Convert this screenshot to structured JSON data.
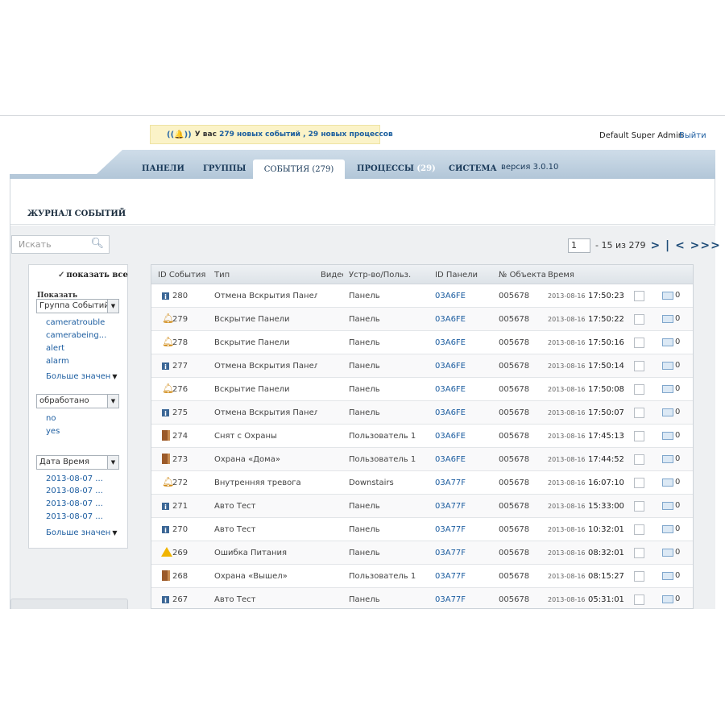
{
  "notice": {
    "prefix": "У вас",
    "events_count": "279",
    "events_text": "новых событий ,",
    "processes_count": "29",
    "processes_text": "новых процессов"
  },
  "header": {
    "user": "Default Super Admin",
    "logout": "Выйти"
  },
  "nav": {
    "tabs": [
      {
        "label": "ПАНЕЛИ"
      },
      {
        "label": "ГРУППЫ"
      },
      {
        "label": "СОБЫТИЯ (279)",
        "active": true
      },
      {
        "label": "ПРОЦЕССЫ",
        "count": "(29)"
      },
      {
        "label": "СИСТЕМА"
      }
    ],
    "version": "версия 3.0.10"
  },
  "page_title": "ЖУРНАЛ СОБЫТИЙ",
  "search": {
    "placeholder": "Искать"
  },
  "pager": {
    "page": "1",
    "range": "- 15 из 279"
  },
  "filter": {
    "show_all": "показать все",
    "show_label": "Показать",
    "group_select": "Группа Событий",
    "group_items": [
      "cameratrouble",
      "camerabeing...",
      "alert",
      "alarm"
    ],
    "more": "Больше значен",
    "processed_select": "обработано",
    "processed_items": [
      "no",
      "yes"
    ],
    "date_select": "Дата Время",
    "date_items": [
      "2013-08-07 ...",
      "2013-08-07 ...",
      "2013-08-07 ...",
      "2013-08-07 ..."
    ],
    "more2": "Больше значен"
  },
  "table": {
    "headers": [
      "ID События",
      "Тип",
      "Видео",
      "Устр-во/Польз.",
      "ID Панели",
      "№ Объекта",
      "Время"
    ],
    "rows": [
      {
        "icon": "info",
        "id": "280",
        "type": "Отмена Вскрытия Панели",
        "device": "Панель",
        "panel": "03A6FE",
        "object": "005678",
        "date": "2013-08-16",
        "time": "17:50:23",
        "mail": "0"
      },
      {
        "icon": "bell",
        "id": "279",
        "type": "Вскрытие Панели",
        "device": "Панель",
        "panel": "03A6FE",
        "object": "005678",
        "date": "2013-08-16",
        "time": "17:50:22",
        "mail": "0"
      },
      {
        "icon": "bell",
        "id": "278",
        "type": "Вскрытие Панели",
        "device": "Панель",
        "panel": "03A6FE",
        "object": "005678",
        "date": "2013-08-16",
        "time": "17:50:16",
        "mail": "0"
      },
      {
        "icon": "info",
        "id": "277",
        "type": "Отмена Вскрытия Панели",
        "device": "Панель",
        "panel": "03A6FE",
        "object": "005678",
        "date": "2013-08-16",
        "time": "17:50:14",
        "mail": "0"
      },
      {
        "icon": "bell",
        "id": "276",
        "type": "Вскрытие Панели",
        "device": "Панель",
        "panel": "03A6FE",
        "object": "005678",
        "date": "2013-08-16",
        "time": "17:50:08",
        "mail": "0"
      },
      {
        "icon": "info",
        "id": "275",
        "type": "Отмена Вскрытия Панели",
        "device": "Панель",
        "panel": "03A6FE",
        "object": "005678",
        "date": "2013-08-16",
        "time": "17:50:07",
        "mail": "0"
      },
      {
        "icon": "door",
        "id": "274",
        "type": "Снят с Охраны",
        "device": "Пользователь 1",
        "panel": "03A6FE",
        "object": "005678",
        "date": "2013-08-16",
        "time": "17:45:13",
        "mail": "0"
      },
      {
        "icon": "door",
        "id": "273",
        "type": "Охрана «Дома»",
        "device": "Пользователь 1",
        "panel": "03A6FE",
        "object": "005678",
        "date": "2013-08-16",
        "time": "17:44:52",
        "mail": "0"
      },
      {
        "icon": "bell",
        "id": "272",
        "type": "Внутренняя тревога",
        "device": "Downstairs",
        "panel": "03A77F",
        "object": "005678",
        "date": "2013-08-16",
        "time": "16:07:10",
        "mail": "0"
      },
      {
        "icon": "info",
        "id": "271",
        "type": "Авто Тест",
        "device": "Панель",
        "panel": "03A77F",
        "object": "005678",
        "date": "2013-08-16",
        "time": "15:33:00",
        "mail": "0"
      },
      {
        "icon": "info",
        "id": "270",
        "type": "Авто Тест",
        "device": "Панель",
        "panel": "03A77F",
        "object": "005678",
        "date": "2013-08-16",
        "time": "10:32:01",
        "mail": "0"
      },
      {
        "icon": "warn",
        "id": "269",
        "type": "Ошибка Питания",
        "device": "Панель",
        "panel": "03A77F",
        "object": "005678",
        "date": "2013-08-16",
        "time": "08:32:01",
        "mail": "0"
      },
      {
        "icon": "door",
        "id": "268",
        "type": "Охрана «Вышел»",
        "device": "Пользователь 1",
        "panel": "03A77F",
        "object": "005678",
        "date": "2013-08-16",
        "time": "08:15:27",
        "mail": "0"
      },
      {
        "icon": "info",
        "id": "267",
        "type": "Авто Тест",
        "device": "Панель",
        "panel": "03A77F",
        "object": "005678",
        "date": "2013-08-16",
        "time": "05:31:01",
        "mail": "0"
      }
    ]
  }
}
